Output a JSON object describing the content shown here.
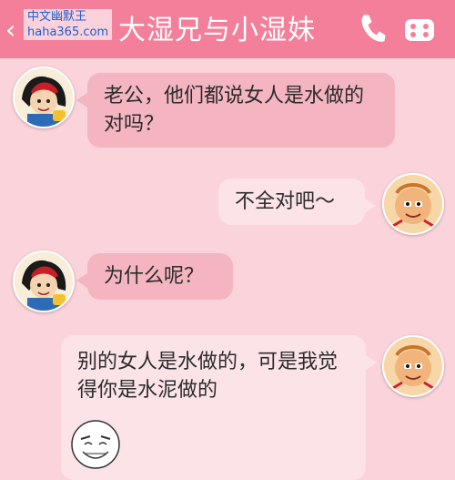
{
  "header": {
    "title": "大湿兄与小湿妹",
    "back_icon": "‹",
    "watermark_line1": "中文幽默王",
    "watermark_line2": "haha365.com"
  },
  "messages": [
    {
      "side": "left",
      "text": "老公，他们都说女人是水做的对吗？"
    },
    {
      "side": "right",
      "text": "不全对吧～"
    },
    {
      "side": "left",
      "text": "为什么呢？"
    },
    {
      "side": "right",
      "text": "别的女人是水做的，可是我觉得你是水泥做的"
    }
  ],
  "colors": {
    "header": "#f47f9a",
    "background": "#fbd3db",
    "bubble_left": "#f4b4c0",
    "bubble_right": "#fbe3e8"
  },
  "icons": [
    "back-chevron-icon",
    "phone-icon",
    "menu-icon",
    "avatar-female",
    "avatar-male",
    "rage-face-icon"
  ]
}
